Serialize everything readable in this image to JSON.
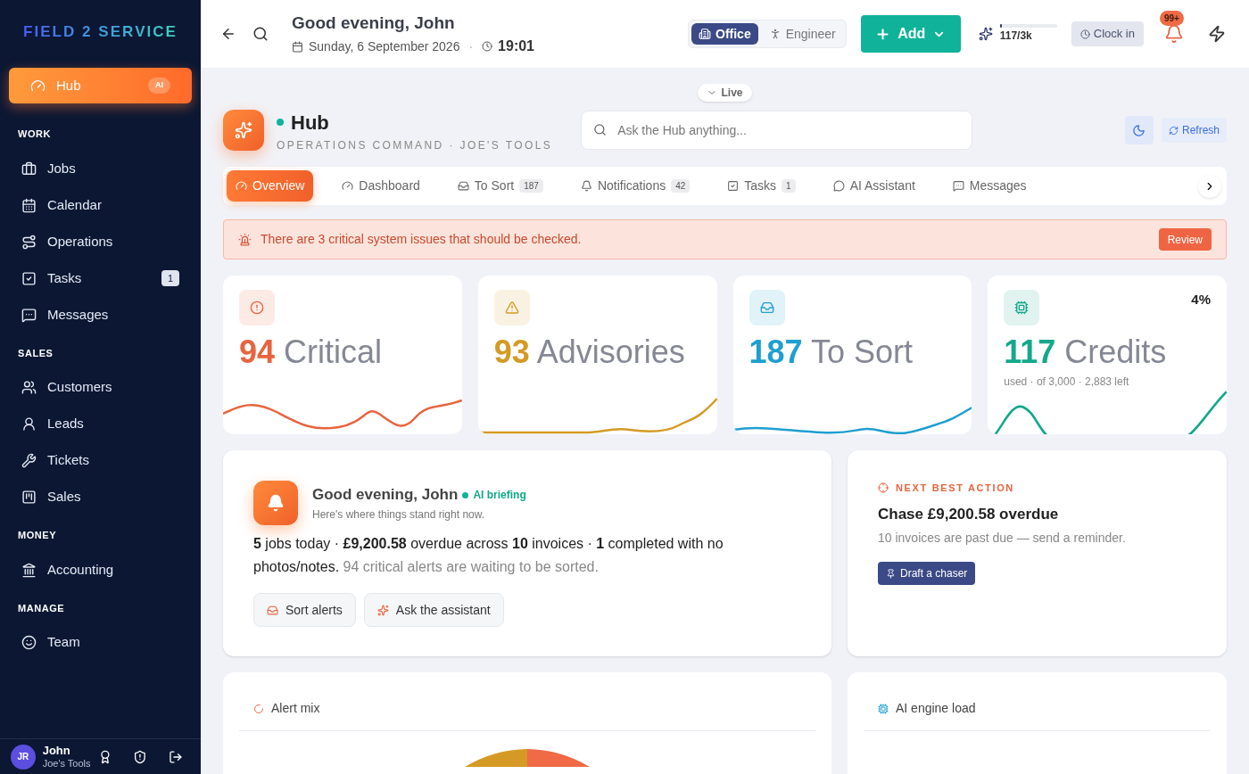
{
  "sidebar": {
    "logo": {
      "part1": "FIELD",
      "part2": "2",
      "part3": "SERVICE"
    },
    "top_items": [
      {
        "label": "Hub",
        "badge": "AI",
        "selected": true
      }
    ],
    "sections": [
      {
        "title": "WORK",
        "items": [
          {
            "label": "Jobs",
            "selected": false
          },
          {
            "label": "Calendar",
            "selected": false
          },
          {
            "label": "Operations",
            "selected": false
          },
          {
            "label": "Tasks",
            "badge": "1",
            "selected": false
          },
          {
            "label": "Messages",
            "selected": false
          }
        ]
      },
      {
        "title": "SALES",
        "items": [
          {
            "label": "Customers",
            "selected": false
          },
          {
            "label": "Leads",
            "selected": false
          },
          {
            "label": "Tickets",
            "selected": false
          },
          {
            "label": "Sales",
            "selected": false
          }
        ]
      },
      {
        "title": "MONEY",
        "items": [
          {
            "label": "Accounting",
            "selected": false
          }
        ]
      },
      {
        "title": "MANAGE",
        "items": [
          {
            "label": "Team",
            "selected": false
          }
        ]
      }
    ],
    "user": {
      "initials": "JR",
      "name": "John",
      "company": "Joe's Tools"
    }
  },
  "topbar": {
    "greeting": "Good evening, John",
    "date": "Sunday, 6 September 2026",
    "separator": "·",
    "time": "19:01",
    "modes": [
      {
        "label": "Office",
        "selected": true
      },
      {
        "label": "Engineer",
        "selected": false
      }
    ],
    "add_button": "Add",
    "credits": {
      "text": "117/3k",
      "level": 0.04
    },
    "clock_in": "Clock in",
    "notifications_badge": "99+"
  },
  "live": "Live",
  "hub": {
    "title": "Hub",
    "subtitle": "OPERATIONS COMMAND · JOE'S TOOLS",
    "search_placeholder": "Ask the Hub anything...",
    "refresh": "Refresh"
  },
  "tabs": [
    {
      "label": "Overview",
      "selected": true
    },
    {
      "label": "Dashboard",
      "selected": false
    },
    {
      "label": "To Sort",
      "count": "187",
      "selected": false
    },
    {
      "label": "Notifications",
      "count": "42",
      "selected": false
    },
    {
      "label": "Tasks",
      "count": "1",
      "selected": false
    },
    {
      "label": "AI Assistant",
      "selected": false
    },
    {
      "label": "Messages",
      "selected": false
    }
  ],
  "alert": {
    "text": "There are 3 critical system issues that should be checked.",
    "button": "Review"
  },
  "stats": [
    {
      "value": "94",
      "label": "Critical",
      "color": "#e8643f"
    },
    {
      "value": "93",
      "label": "Advisories",
      "color": "#d49a24"
    },
    {
      "value": "187",
      "label": "To Sort",
      "color": "#1f9fd0"
    },
    {
      "value": "117",
      "label": "Credits",
      "color": "#14a88a",
      "percent": "4%",
      "note": "used · of 3,000 · 2,883 left"
    }
  ],
  "briefing": {
    "title": "Good evening, John",
    "tag": "AI briefing",
    "subtitle": "Here's where things stand right now.",
    "summary": "**5** jobs today · **£9,200.58** overdue across **10** invoices · **1** completed with no photos/notes.",
    "summary_muted": "94 critical alerts are waiting to be sorted.",
    "buttons": [
      "Sort alerts",
      "Ask the assistant"
    ]
  },
  "next_action": {
    "label": "NEXT BEST ACTION",
    "title": "Chase £9,200.58 overdue",
    "description": "10 invoices are past due — send a reminder.",
    "button": "Draft a chaser"
  },
  "panels": [
    {
      "title": "Alert mix"
    },
    {
      "title": "AI engine load"
    }
  ]
}
